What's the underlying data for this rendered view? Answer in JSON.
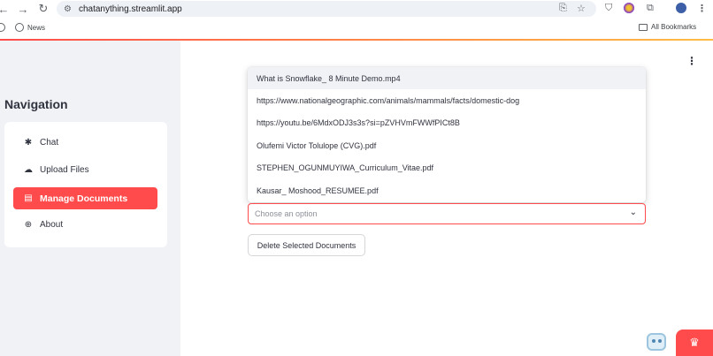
{
  "browser": {
    "url": "chatanything.streamlit.app",
    "back_icon": "back-arrow-icon",
    "forward_icon": "forward-arrow-icon",
    "reload_icon": "reload-icon",
    "bookmarks": [
      {
        "label": "News"
      }
    ],
    "all_bookmarks_label": "All Bookmarks"
  },
  "sidebar": {
    "title": "Navigation",
    "items": [
      {
        "label": "Chat",
        "icon": "snowflake-icon",
        "glyph": "✱",
        "active": false
      },
      {
        "label": "Upload Files",
        "icon": "cloud-upload-icon",
        "glyph": "☁",
        "active": false
      },
      {
        "label": "Manage Documents",
        "icon": "document-icon",
        "glyph": "▤",
        "active": true
      },
      {
        "label": "About",
        "icon": "plus-circle-icon",
        "glyph": "⊕",
        "active": false
      }
    ],
    "accent": "#ff4b4b"
  },
  "main": {
    "options": [
      "What is Snowflake_ 8 Minute Demo.mp4",
      "https://www.nationalgeographic.com/animals/mammals/facts/domestic-dog",
      "https://youtu.be/6MdxODJ3s3s?si=pZVHVmFWWfPICt8B",
      "Olufemi Victor Tolulope (CVG).pdf",
      "STEPHEN_OGUNMUYIWA_Curriculum_Vitae.pdf",
      "Kausar_ Moshood_RESUMEE.pdf"
    ],
    "select_placeholder": "Choose an option",
    "delete_button_label": "Delete Selected Documents"
  }
}
